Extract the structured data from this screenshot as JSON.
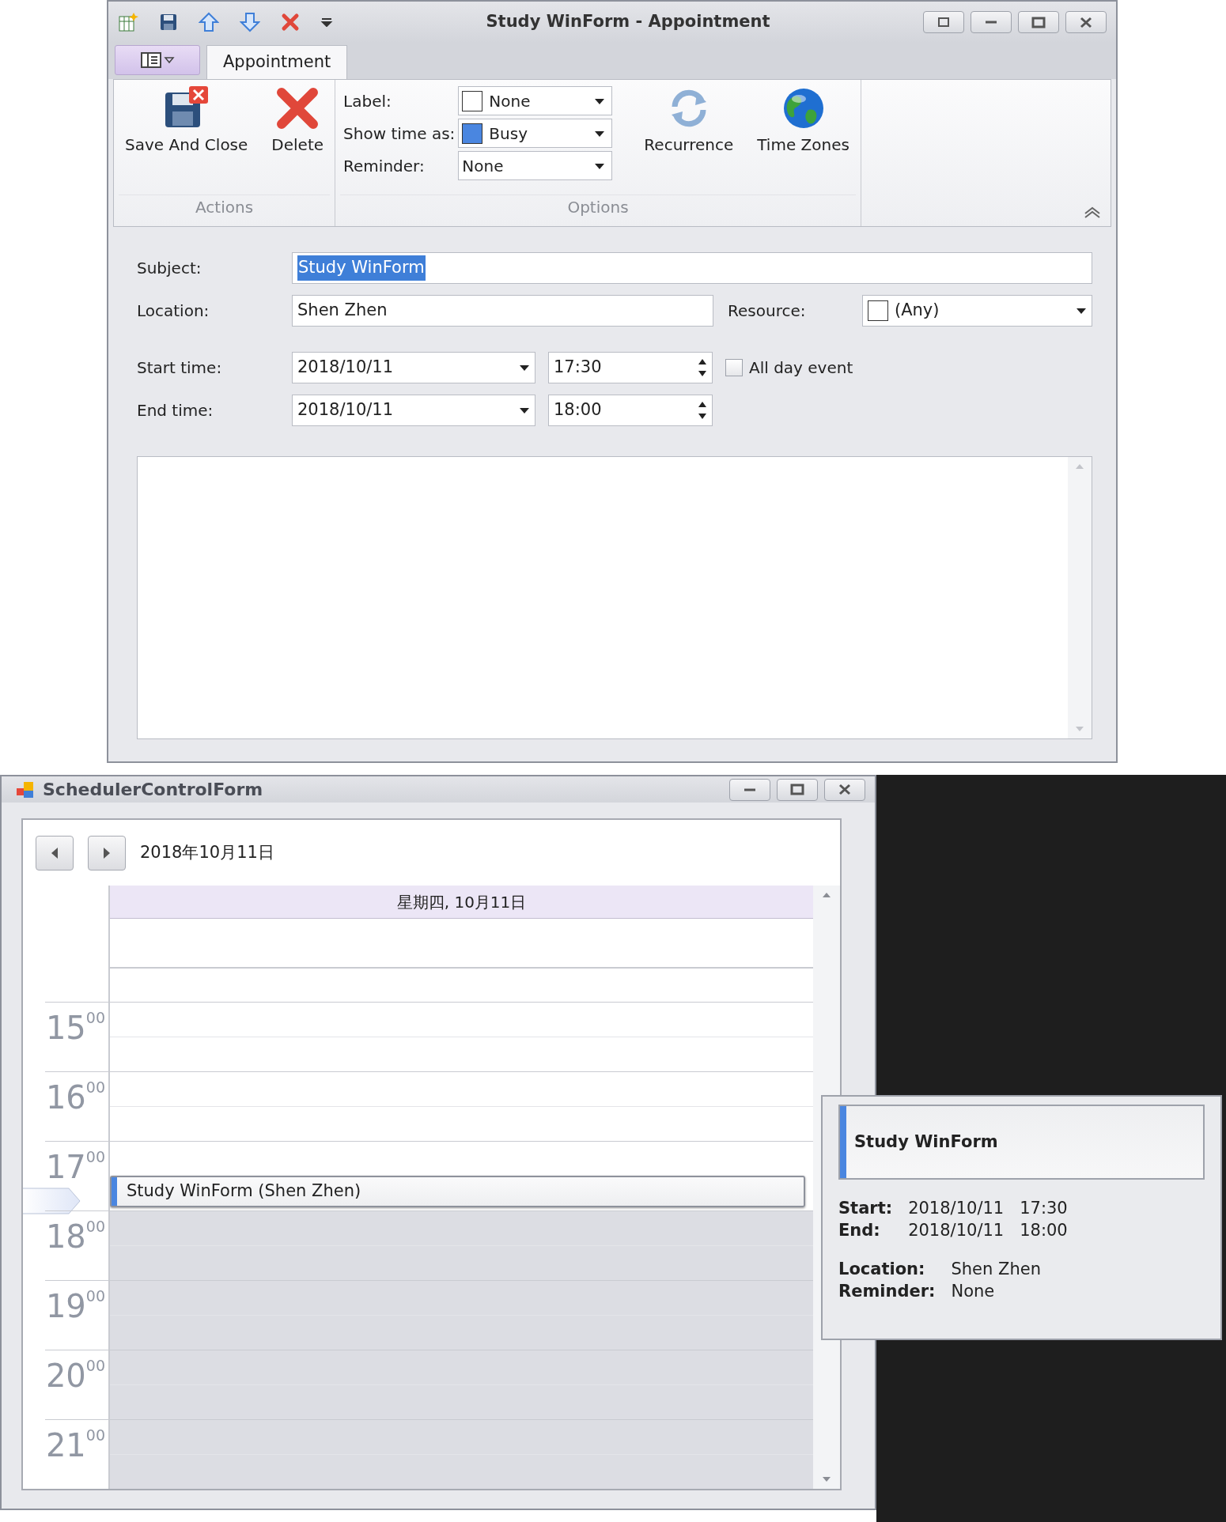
{
  "appointment_window": {
    "title": "Study WinForm - Appointment",
    "tabs": [
      {
        "label": "Appointment",
        "selected": true
      }
    ],
    "ribbon": {
      "groups": [
        {
          "caption": "Actions",
          "buttons": [
            {
              "label": "Save And Close",
              "kind": "save"
            },
            {
              "label": "Delete",
              "kind": "delete"
            }
          ]
        },
        {
          "caption": "Options",
          "fields": [
            {
              "label": "Label:",
              "value": "None",
              "color": "#ffffff"
            },
            {
              "label": "Show time as:",
              "value": "Busy",
              "color": "#4a86e0"
            },
            {
              "label": "Reminder:",
              "value": "None"
            }
          ],
          "buttons": [
            {
              "label": "Recurrence",
              "kind": "recurrence"
            },
            {
              "label": "Time Zones",
              "kind": "globe"
            }
          ]
        }
      ]
    },
    "form": {
      "subject": {
        "label": "Subject:",
        "value": "Study WinForm",
        "text_selected": true
      },
      "location": {
        "label": "Location:",
        "value": "Shen Zhen"
      },
      "resource": {
        "label": "Resource:",
        "value": "(Any)"
      },
      "start": {
        "label": "Start time:",
        "date": "2018/10/11",
        "time": "17:30"
      },
      "end": {
        "label": "End time:",
        "date": "2018/10/11",
        "time": "18:00"
      },
      "all_day": {
        "label": "All day event",
        "checked": false
      }
    }
  },
  "scheduler_window": {
    "title": "SchedulerControlForm",
    "date": "2018年10月11日",
    "day_header": "星期四, 10月11日",
    "hours": [
      {
        "hour": "15",
        "minutes": "00",
        "work_time": true
      },
      {
        "hour": "16",
        "minutes": "00",
        "work_time": true
      },
      {
        "hour": "17",
        "minutes": "00",
        "work_time": true,
        "appointment": "Study WinForm (Shen Zhen)"
      },
      {
        "hour": "18",
        "minutes": "00",
        "work_time": false
      },
      {
        "hour": "19",
        "minutes": "00",
        "work_time": false
      },
      {
        "hour": "20",
        "minutes": "00",
        "work_time": false
      },
      {
        "hour": "21",
        "minutes": "00",
        "work_time": false
      }
    ]
  },
  "tooltip": {
    "title": "Study WinForm",
    "times": [
      {
        "label": "Start:",
        "date": "2018/10/11",
        "time": "17:30"
      },
      {
        "label": "End:",
        "date": "2018/10/11",
        "time": "18:00"
      }
    ],
    "details": [
      {
        "label": "Location:",
        "value": "Shen Zhen"
      },
      {
        "label": "Reminder:",
        "value": "None"
      }
    ]
  }
}
